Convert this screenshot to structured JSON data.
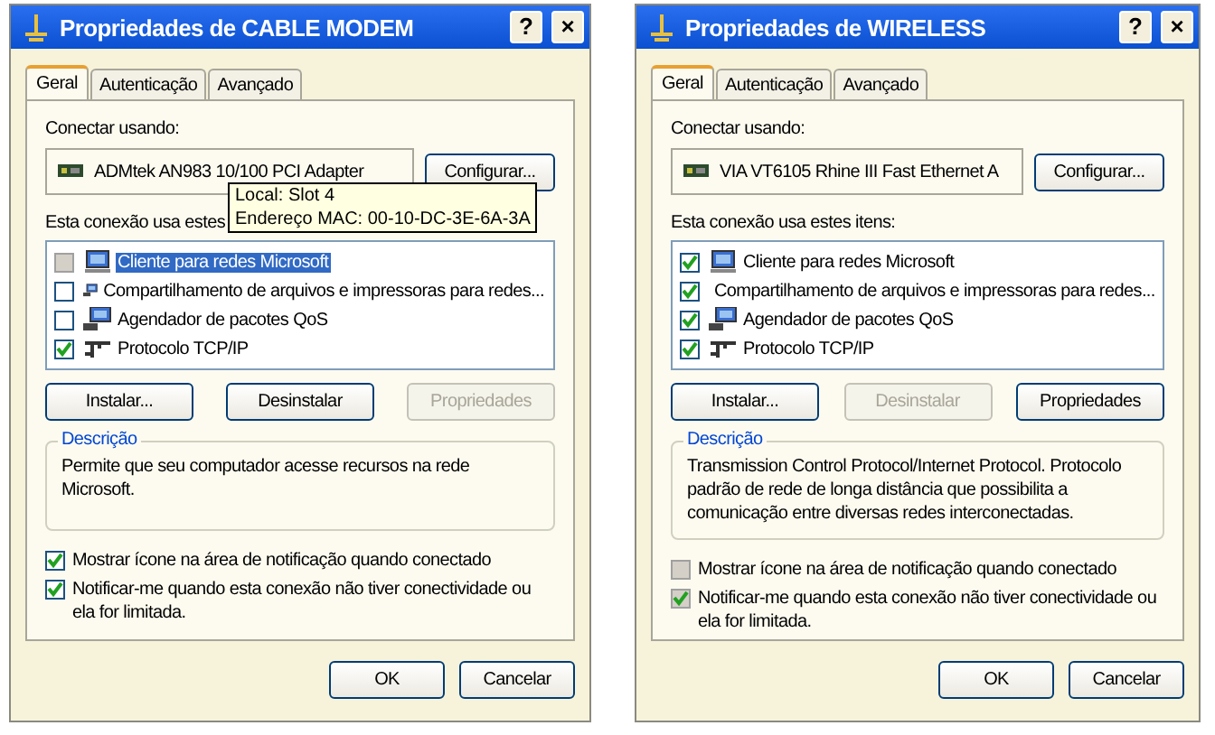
{
  "dialogs": [
    {
      "title": "Propriedades de CABLE MODEM",
      "help": "?",
      "close": "×",
      "tabs": [
        {
          "label": "Geral",
          "selected": true
        },
        {
          "label": "Autenticação",
          "selected": false
        },
        {
          "label": "Avançado",
          "selected": false
        }
      ],
      "connect_label": "Conectar usando:",
      "adapter": "ADMtek AN983 10/100 PCI Adapter",
      "configure": "Configurar...",
      "tooltip": [
        "Local: Slot 4",
        "Endereço MAC: 00-10-DC-3E-6A-3A"
      ],
      "items_label": "Esta conexão usa estes",
      "items": [
        {
          "kind": "client",
          "label": "Cliente para redes Microsoft",
          "checked": false,
          "selected": true
        },
        {
          "kind": "service",
          "label": "Compartilhamento de arquivos e impressoras para redes...",
          "checked": false,
          "selected": false
        },
        {
          "kind": "service",
          "label": "Agendador de pacotes QoS",
          "checked": false,
          "selected": false
        },
        {
          "kind": "protocol",
          "label": "Protocolo TCP/IP",
          "checked": true,
          "selected": false
        }
      ],
      "buttons": [
        {
          "label": "Instalar...",
          "disabled": false
        },
        {
          "label": "Desinstalar",
          "disabled": false
        },
        {
          "label": "Propriedades",
          "disabled": true
        }
      ],
      "description_legend": "Descrição",
      "description": "Permite que seu computador acesse recursos na rede Microsoft.",
      "options": [
        {
          "label": "Mostrar ícone na área de notificação quando conectado",
          "checked": true,
          "disabled": false
        },
        {
          "label": "Notificar-me quando esta conexão não tiver conectividade ou ela for limitada.",
          "checked": true,
          "disabled": false
        }
      ],
      "footer": [
        "OK",
        "Cancelar"
      ]
    },
    {
      "title": "Propriedades de WIRELESS",
      "help": "?",
      "close": "×",
      "tabs": [
        {
          "label": "Geral",
          "selected": true
        },
        {
          "label": "Autenticação",
          "selected": false
        },
        {
          "label": "Avançado",
          "selected": false
        }
      ],
      "connect_label": "Conectar usando:",
      "adapter": "VIA VT6105 Rhine III Fast Ethernet A",
      "configure": "Configurar...",
      "items_label": "Esta conexão usa estes itens:",
      "items": [
        {
          "kind": "client",
          "label": "Cliente para redes Microsoft",
          "checked": true,
          "selected": false
        },
        {
          "kind": "service",
          "label": "Compartilhamento de arquivos e impressoras para redes...",
          "checked": true,
          "selected": false
        },
        {
          "kind": "service",
          "label": "Agendador de pacotes QoS",
          "checked": true,
          "selected": false
        },
        {
          "kind": "protocol",
          "label": "Protocolo TCP/IP",
          "checked": true,
          "selected": false
        }
      ],
      "buttons": [
        {
          "label": "Instalar...",
          "disabled": false
        },
        {
          "label": "Desinstalar",
          "disabled": true
        },
        {
          "label": "Propriedades",
          "disabled": false
        }
      ],
      "description_legend": "Descrição",
      "description": "Transmission Control Protocol/Internet Protocol. Protocolo padrão de rede de longa distância que possibilita a comunicação entre diversas redes interconectadas.",
      "options": [
        {
          "label": "Mostrar ícone na área de notificação quando conectado",
          "checked": false,
          "disabled": true
        },
        {
          "label": "Notificar-me quando esta conexão não tiver conectividade ou ela for limitada.",
          "checked": true,
          "disabled": true
        }
      ],
      "footer": [
        "OK",
        "Cancelar"
      ]
    }
  ]
}
